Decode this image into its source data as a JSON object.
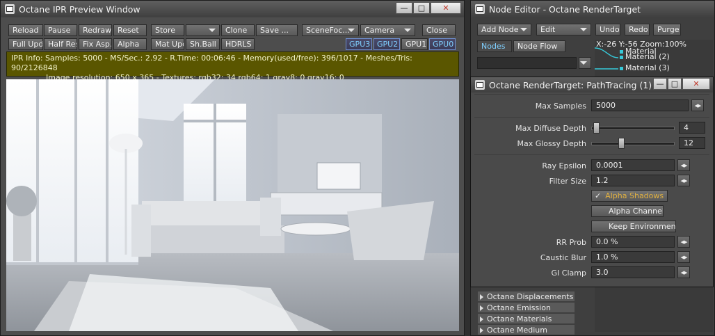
{
  "ipr_window": {
    "title": "Octane IPR Preview Window",
    "toolbar_row1": [
      "Reload",
      "Pause",
      "Redraw",
      "Reset",
      "Store",
      "",
      "Clone",
      "Save ...",
      "SceneFoc...",
      "Camera",
      "Close"
    ],
    "toolbar_row2": [
      "Full Upd.",
      "Half Res",
      "Fix Asp.",
      "Alpha",
      "Mat Upd",
      "Sh.Ball",
      "HDRLS"
    ],
    "gpus": [
      "GPU3",
      "GPU2",
      "GPU1",
      "GPU0"
    ],
    "info_line1": "IPR Info:  Samples: 5000  -  MS/Sec.: 2.92  -  R.Time: 00:06:46 - Memory(used/free): 396/1017  -  Meshes/Tris: 90/2126848",
    "info_line2": "Image resolution: 650 x 365 - Textures:  rgb32: 34   rgb64: 1   gray8: 0   gray16: 0",
    "render_description": "rendered interior living room"
  },
  "node_editor": {
    "title": "Node Editor - Octane RenderTarget",
    "add_node": "Add Node",
    "edit": "Edit",
    "undo": "Undo",
    "redo": "Redo",
    "purge": "Purge",
    "tab_nodes": "Nodes",
    "tab_node_flow": "Node Flow",
    "coords": "X:-26 Y:-56 Zoom:100%",
    "materials": [
      "Material",
      "Material (2)",
      "Material (3)"
    ],
    "tree_items": [
      "Octane Displacements",
      "Octane Emission",
      "Octane Materials",
      "Octane Medium"
    ]
  },
  "render_target": {
    "title": "Octane RenderTarget: PathTracing (1)",
    "max_samples_label": "Max Samples",
    "max_samples": "5000",
    "max_diffuse_label": "Max Diffuse Depth",
    "max_diffuse": "4",
    "max_diffuse_level": 0.03,
    "max_glossy_label": "Max Glossy Depth",
    "max_glossy": "12",
    "max_glossy_level": 0.35,
    "ray_epsilon_label": "Ray Epsilon",
    "ray_epsilon": "0.0001",
    "filter_size_label": "Filter Size",
    "filter_size": "1.2",
    "alpha_shadows": "Alpha Shadows",
    "alpha_channel": "Alpha Channel",
    "keep_environment": "Keep Environment",
    "rr_prob_label": "RR Prob",
    "rr_prob": "0.0 %",
    "caustic_blur_label": "Caustic Blur",
    "caustic_blur": "1.0 %",
    "gi_clamp_label": "GI Clamp",
    "gi_clamp": "3.0"
  },
  "colors": {
    "accent": "#e0b040",
    "gpu_text": "#7fd0ff",
    "info_bg": "#5a5600"
  }
}
